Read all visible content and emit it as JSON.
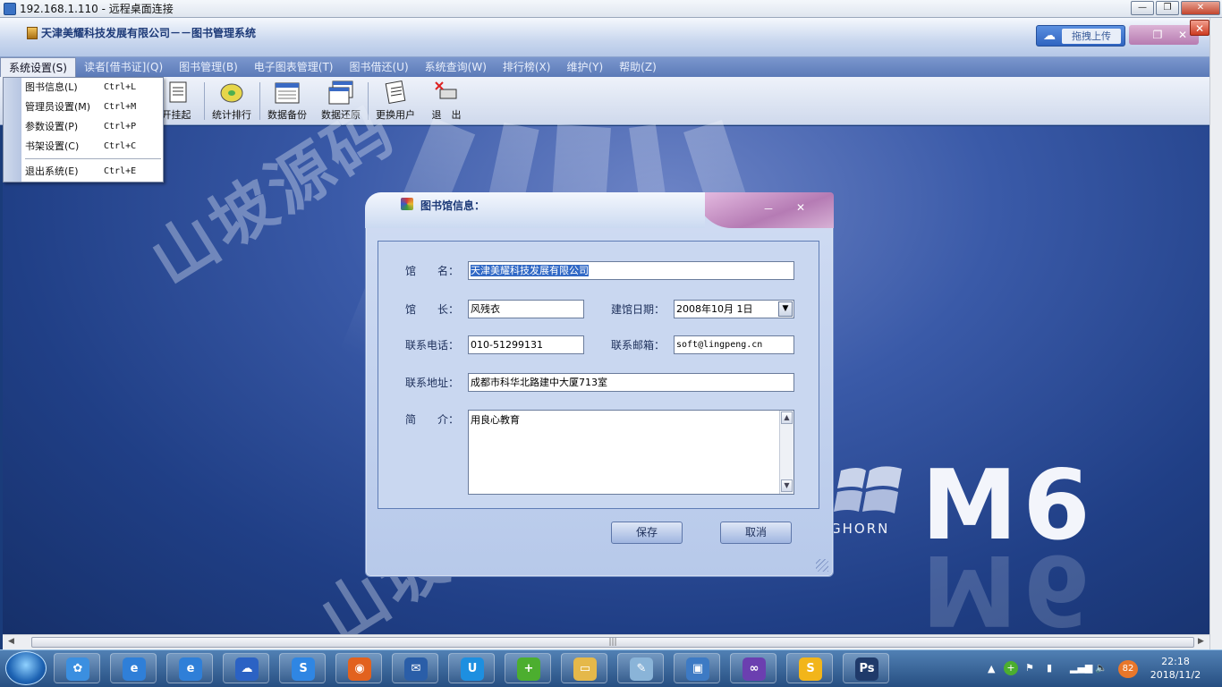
{
  "rdp": {
    "title": "192.168.1.110 - 远程桌面连接",
    "minimize": "—",
    "restore": "❐",
    "close": "✕"
  },
  "app": {
    "title": "天津美耀科技发展有限公司－－图书管理系统",
    "upload_label": "拖拽上传",
    "close": "✕"
  },
  "menubar": [
    {
      "label": "系统设置(S)",
      "active": true
    },
    {
      "label": "读者[借书证](Q)",
      "active": false
    },
    {
      "label": "图书管理(B)",
      "active": false
    },
    {
      "label": "电子图表管理(T)",
      "active": false
    },
    {
      "label": "图书借还(U)",
      "active": false
    },
    {
      "label": "系统查询(W)",
      "active": false
    },
    {
      "label": "排行榜(X)",
      "active": false
    },
    {
      "label": "维护(Y)",
      "active": false
    },
    {
      "label": "帮助(Z)",
      "active": false
    }
  ],
  "toolbar": [
    {
      "label": "开挂起"
    },
    {
      "label": "统计排行"
    },
    {
      "label": "数据备份"
    },
    {
      "label": "数据还原"
    },
    {
      "label": "更换用户"
    },
    {
      "label": "退　出"
    }
  ],
  "system_menu": [
    {
      "label": "图书信息(L)",
      "shortcut": "Ctrl+L"
    },
    {
      "label": "管理员设置(M)",
      "shortcut": "Ctrl+M"
    },
    {
      "label": "参数设置(P)",
      "shortcut": "Ctrl+P"
    },
    {
      "label": "书架设置(C)",
      "shortcut": "Ctrl+C"
    },
    {
      "label": "退出系统(E)",
      "shortcut": "Ctrl+E"
    }
  ],
  "dialog": {
    "title": "图书馆信息：",
    "min": "－",
    "close": "✕",
    "fields": {
      "name_label": "馆　　名：",
      "name_value": "天津美耀科技发展有限公司",
      "curator_label": "馆　　长：",
      "curator_value": "风残衣",
      "founded_label": "建馆日期：",
      "founded_value": "2008年10月 1日",
      "phone_label": "联系电话：",
      "phone_value": "010-51299131",
      "email_label": "联系邮箱：",
      "email_value": "soft@lingpeng.cn",
      "address_label": "联系地址：",
      "address_value": "成都市科华北路建中大厦713室",
      "intro_label": "简　　介：",
      "intro_value": "用良心教育"
    },
    "save_label": "保存",
    "cancel_label": "取消"
  },
  "desktop": {
    "brand": "M6",
    "brand_sub": "GHORN"
  },
  "watermark": "山坡源码",
  "taskbar": {
    "time": "22:18",
    "date": "2018/11/2",
    "badge": "82",
    "apps": [
      {
        "icon": "pinwheel-icon",
        "color": "#3b8fe0"
      },
      {
        "icon": "ie-icon",
        "color": "#2f7fd8"
      },
      {
        "icon": "ie-icon",
        "color": "#2f7fd8"
      },
      {
        "icon": "cloud-icon",
        "color": "#2b62c4"
      },
      {
        "icon": "sogou-icon",
        "color": "#2f86e3"
      },
      {
        "icon": "firefox-icon",
        "color": "#e2621e"
      },
      {
        "icon": "mail-icon",
        "color": "#2a5ea8"
      },
      {
        "icon": "shield-icon",
        "color": "#1d8fe0"
      },
      {
        "icon": "plus-icon",
        "color": "#4cae2f"
      },
      {
        "icon": "folder-icon",
        "color": "#e5b84a"
      },
      {
        "icon": "notepad-icon",
        "color": "#8ab4d8"
      },
      {
        "icon": "remote-desktop-icon",
        "color": "#3d7ac4"
      },
      {
        "icon": "visual-studio-icon",
        "color": "#6b3fb0"
      },
      {
        "icon": "sublime-icon",
        "color": "#f2b51a"
      },
      {
        "icon": "photoshop-icon",
        "color": "#1f3a6a"
      }
    ]
  }
}
